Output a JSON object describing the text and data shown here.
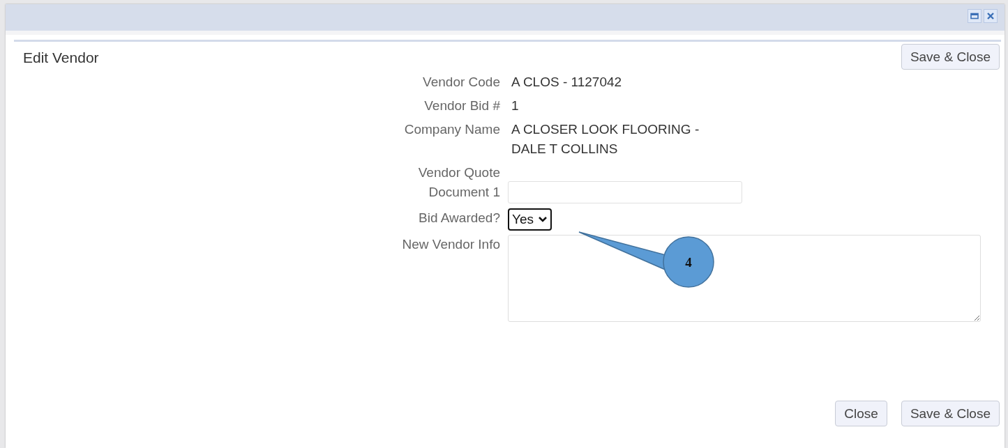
{
  "window": {
    "title": "Edit Vendor",
    "controls": [
      {
        "kind": "maximize"
      },
      {
        "kind": "close"
      }
    ]
  },
  "top_button": "Save & Close",
  "fields": [
    {
      "kind": "text",
      "label": "Vendor Code",
      "value": "A CLOS - 1127042"
    },
    {
      "kind": "text",
      "label": "Vendor Bid #",
      "value": "1"
    },
    {
      "kind": "text",
      "label": "Company Name",
      "value": "A CLOSER LOOK FLOORING -\nDALE T COLLINS"
    },
    {
      "kind": "input",
      "label": "Vendor Quote\nDocument 1"
    },
    {
      "kind": "select",
      "label": "Bid Awarded?",
      "value": "Yes"
    },
    {
      "kind": "textarea",
      "label": "New Vendor Info"
    }
  ],
  "callout": {
    "number": "4"
  },
  "footer_buttons": [
    "Close",
    "Save & Close"
  ]
}
